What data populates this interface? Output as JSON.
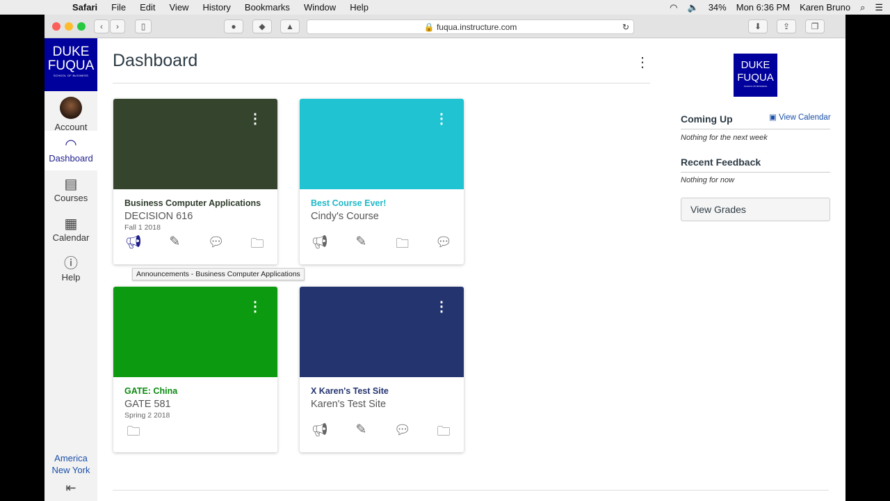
{
  "menubar": {
    "app": "Safari",
    "items": [
      "File",
      "Edit",
      "View",
      "History",
      "Bookmarks",
      "Window",
      "Help"
    ],
    "battery": "34%",
    "clock": "Mon 6:36 PM",
    "user": "Karen Bruno"
  },
  "browser": {
    "url": "fuqua.instructure.com"
  },
  "sidebar": {
    "logo": {
      "line1": "DUKE",
      "line2": "FUQUA",
      "line3": "SCHOOL OF BUSINESS"
    },
    "items": [
      {
        "label": "Account"
      },
      {
        "label": "Dashboard"
      },
      {
        "label": "Courses"
      },
      {
        "label": "Calendar"
      },
      {
        "label": "Help"
      }
    ],
    "timezone": "America New York"
  },
  "page": {
    "title": "Dashboard"
  },
  "cards": [
    {
      "name": "Business Computer Applications",
      "code": "DECISION 616",
      "term": "Fall 1 2018",
      "color": "#35442d",
      "name_color": "#2d3b2a"
    },
    {
      "name": "Best Course Ever!",
      "code": "Cindy's Course",
      "term": "",
      "color": "#1fc3d1",
      "name_color": "#1fb9c7"
    },
    {
      "name": "GATE: China",
      "code": "GATE 581",
      "term": "Spring 2 2018",
      "color": "#0b9a10",
      "name_color": "#0b8a10"
    },
    {
      "name": "X Karen's Test Site",
      "code": "Karen's Test Site",
      "term": "",
      "color": "#24346f",
      "name_color": "#24346f"
    }
  ],
  "tooltip": "Announcements - Business Computer Applications",
  "right": {
    "coming_up": "Coming Up",
    "view_calendar": "View Calendar",
    "coming_empty": "Nothing for the next week",
    "feedback": "Recent Feedback",
    "feedback_empty": "Nothing for now",
    "view_grades": "View Grades"
  }
}
